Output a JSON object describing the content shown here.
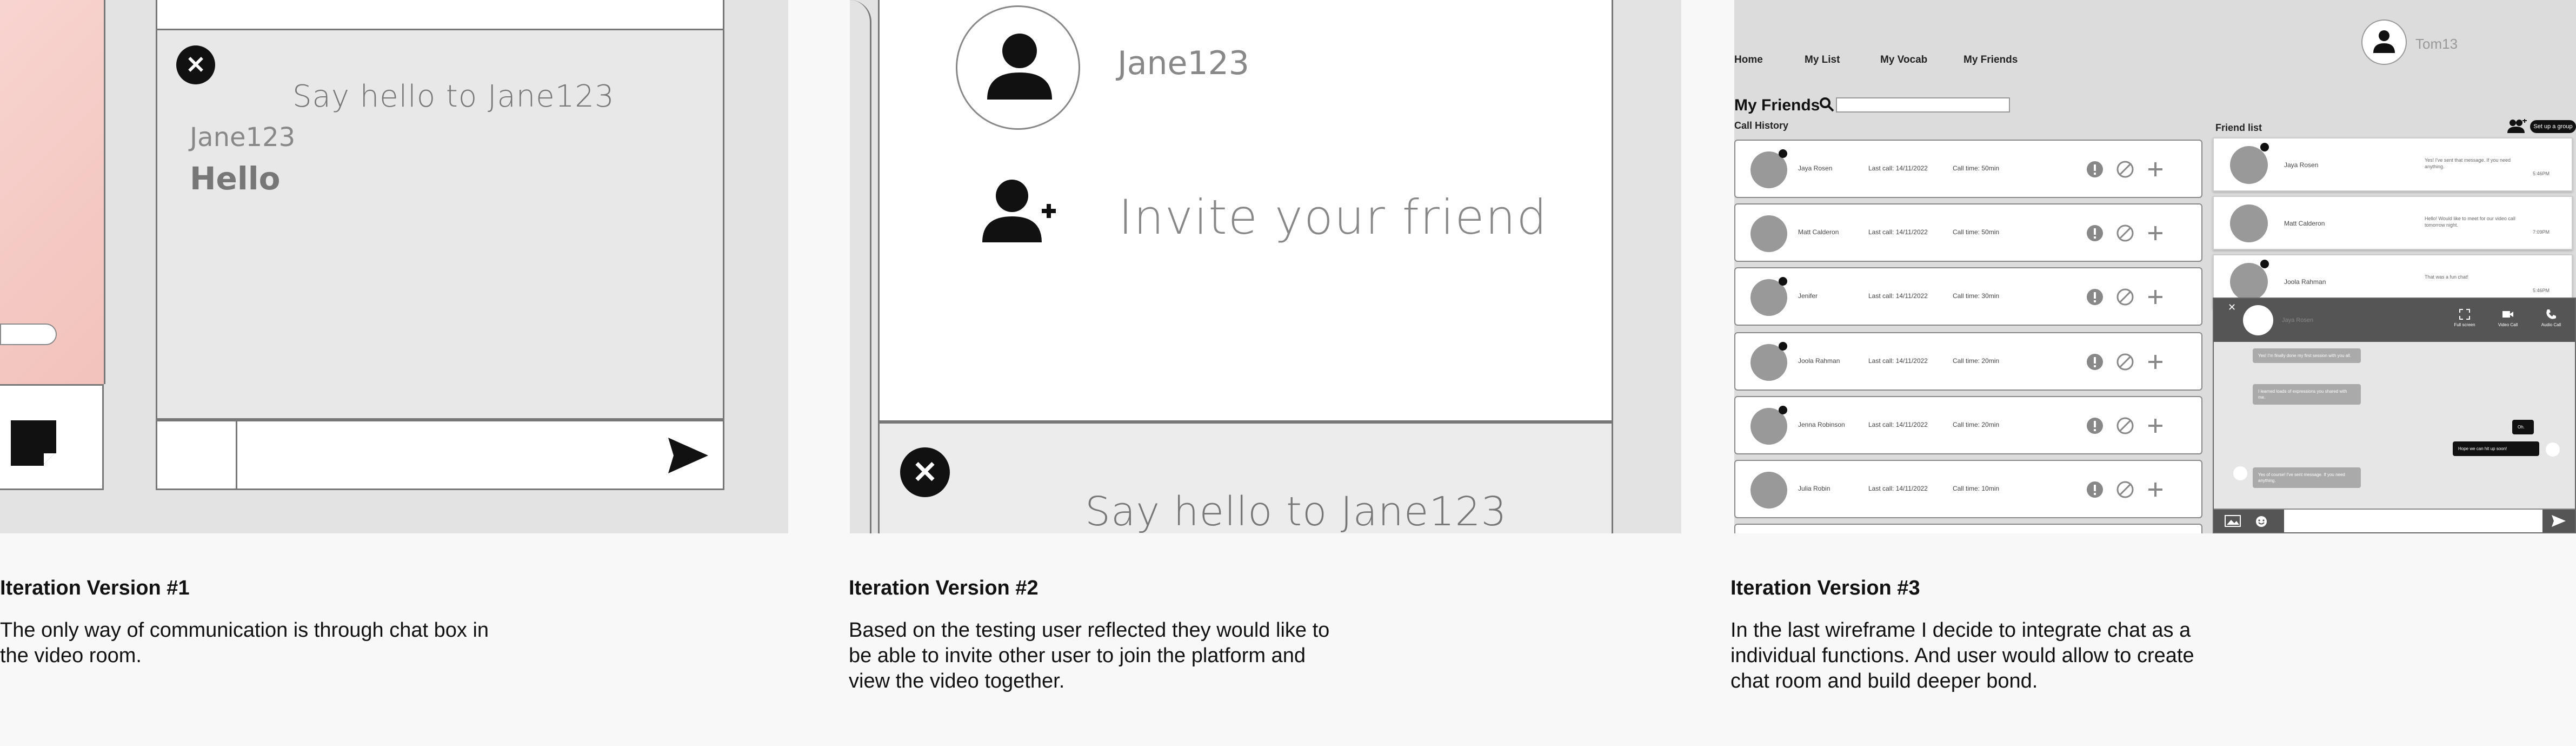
{
  "panel1": {
    "chat_header": "Say hello to Jane123",
    "message": {
      "sender": "Jane123",
      "text": "Hello"
    },
    "close_icon": "close-icon",
    "send_icon": "send-icon",
    "note_icon": "sticky-note-icon"
  },
  "panel2": {
    "user_name": "Jane123",
    "invite_label": "Invite your friend",
    "chat_header": "Say hello to Jane123",
    "close_icon": "close-icon",
    "add_friend_icon": "add-friend-icon"
  },
  "panel3": {
    "nav": [
      "Home",
      "My List",
      "My Vocab",
      "My Friends"
    ],
    "profile_name": "Tom13",
    "section_title": "My Friends",
    "call_history_label": "Call History",
    "friend_list_label": "Friend list",
    "group_button": "Set up a group",
    "call_history": [
      {
        "name": "Jaya Rosen",
        "last_call": "Last call: 14/11/2022",
        "call_time": "Call time: 50min",
        "online": true
      },
      {
        "name": "Matt Calderon",
        "last_call": "Last call: 14/11/2022",
        "call_time": "Call time: 50min",
        "online": false
      },
      {
        "name": "Jenifer",
        "last_call": "Last call: 14/11/2022",
        "call_time": "Call time: 30min",
        "online": true
      },
      {
        "name": "Joola Rahman",
        "last_call": "Last call: 14/11/2022",
        "call_time": "Call time: 20min",
        "online": true
      },
      {
        "name": "Jenna Robinson",
        "last_call": "Last call: 14/11/2022",
        "call_time": "Call time: 20min",
        "online": true
      },
      {
        "name": "Julia Robin",
        "last_call": "Last call: 14/11/2022",
        "call_time": "Call time: 10min",
        "online": false
      }
    ],
    "friend_list": [
      {
        "name": "Jaya Rosen",
        "message": "Yes! I've sent that message. If you need anything.",
        "time": "5:46PM",
        "online": true
      },
      {
        "name": "Matt Calderon",
        "message": "Hello! Would like to meet for our video call tomorrow night.",
        "time": "7:09PM",
        "online": false
      },
      {
        "name": "Joola Rahman",
        "message": "That was a fun chat!",
        "time": "5:46PM",
        "online": true
      }
    ],
    "video_chat": {
      "name": "Jaya Rosen",
      "controls": [
        "Full screen",
        "Video Call",
        "Audio Call"
      ],
      "messages": [
        {
          "text": "Yes! I'm finally done my first session with you all.",
          "side": "left"
        },
        {
          "text": "I learned loads of expressions you shared with me.",
          "side": "left"
        },
        {
          "text": "Oh.",
          "side": "right"
        },
        {
          "text": "Hope we can hit up soon!",
          "side": "right"
        },
        {
          "text": "Yes of course! I've sent message. If you need anything.",
          "side": "left"
        }
      ]
    },
    "colors": {
      "online_dot": "#111111",
      "avatar": "#999999"
    }
  },
  "captions": [
    {
      "title": "Iteration Version #1",
      "desc": "The only way of communication is through chat box in the video room."
    },
    {
      "title": "Iteration Version #2",
      "desc": "Based on the testing user reflected they would like to be able to invite other user to join the platform and view the video together."
    },
    {
      "title": "Iteration Version #3",
      "desc": "In the last wireframe I decide to integrate chat as a individual functions. And user would allow to create chat room and build deeper bond."
    }
  ]
}
